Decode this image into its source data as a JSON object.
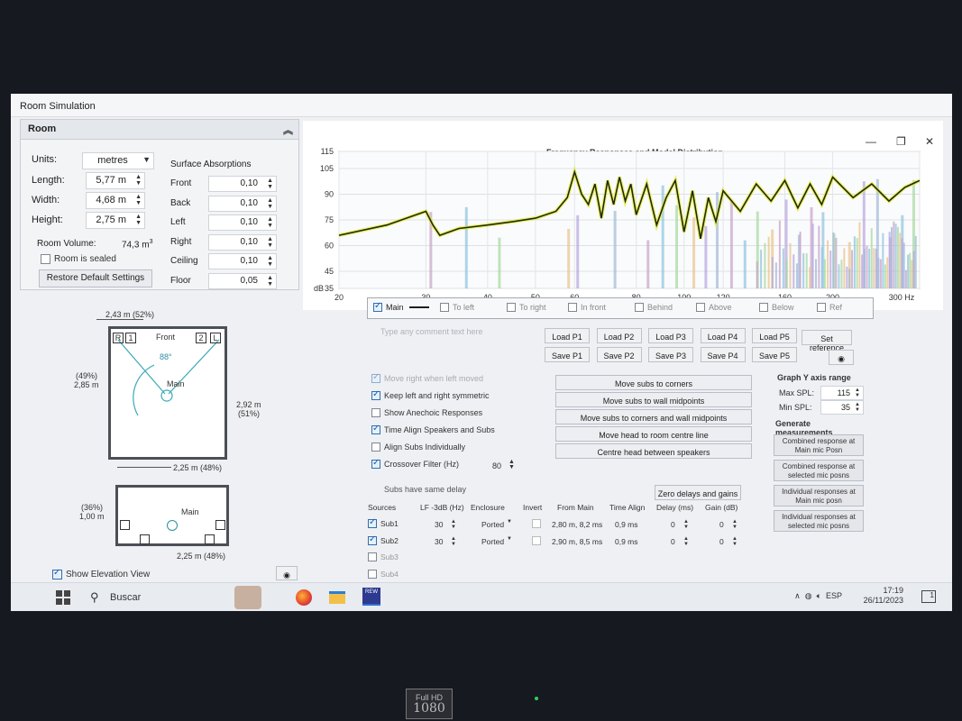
{
  "window_title": "Room Simulation",
  "room_panel": {
    "title": "Room",
    "units_label": "Units:",
    "units_value": "metres",
    "length_label": "Length:",
    "length_value": "5,77 m",
    "width_label": "Width:",
    "width_value": "4,68 m",
    "height_label": "Height:",
    "height_value": "2,75 m",
    "volume_label": "Room Volume:",
    "volume_value": "74,3 m",
    "volume_exp": "3",
    "sealed_label": "Room is sealed",
    "restore_label": "Restore Default Settings",
    "surface_title": "Surface Absorptions",
    "surfaces": [
      {
        "label": "Front",
        "value": "0,10"
      },
      {
        "label": "Back",
        "value": "0,10"
      },
      {
        "label": "Left",
        "value": "0,10"
      },
      {
        "label": "Right",
        "value": "0,10"
      },
      {
        "label": "Ceiling",
        "value": "0,10"
      },
      {
        "label": "Floor",
        "value": "0,05"
      }
    ]
  },
  "plan_view": {
    "top_dim": "2,43 m (52%)",
    "front_label": "Front",
    "angle": "88°",
    "main_label": "Main",
    "left_dim_pct": "(49%)",
    "left_dim": "2,85 m",
    "right_dim": "2,92 m",
    "right_dim_pct": "(51%)",
    "bottom_dim": "2,25 m (48%)",
    "speaker_r": "R",
    "speaker_1": "1",
    "speaker_2": "2",
    "speaker_l": "L"
  },
  "elevation_view": {
    "left_dim_pct": "(36%)",
    "left_dim": "1,00 m",
    "main_label": "Main",
    "bottom_dim": "2,25 m (48%)",
    "show_label": "Show Elevation View"
  },
  "graph": {
    "title": "Frequency Responses and Modal Distribution",
    "y_unit": "dB",
    "y_ticks": [
      "115",
      "105",
      "90",
      "75",
      "60",
      "45",
      "35"
    ],
    "x_ticks": [
      "20",
      "30",
      "40",
      "50",
      "60",
      "80",
      "100",
      "120",
      "160",
      "200",
      "300 Hz"
    ]
  },
  "chart_data": {
    "type": "line",
    "title": "Frequency Responses and Modal Distribution",
    "xlabel": "Hz",
    "ylabel": "dB",
    "ylim": [
      35,
      115
    ],
    "xlim": [
      20,
      300
    ],
    "series": [
      {
        "name": "Main",
        "x": [
          20,
          25,
          28,
          30,
          31,
          32,
          35,
          40,
          45,
          50,
          55,
          58,
          60,
          62,
          64,
          66,
          68,
          70,
          72,
          74,
          76,
          78,
          80,
          84,
          88,
          92,
          96,
          100,
          104,
          108,
          112,
          116,
          120,
          130,
          140,
          150,
          160,
          170,
          180,
          190,
          200,
          220,
          240,
          260,
          280,
          300
        ],
        "y": [
          66,
          72,
          77,
          80,
          72,
          66,
          70,
          72,
          74,
          76,
          80,
          88,
          103,
          90,
          84,
          96,
          76,
          98,
          84,
          100,
          86,
          96,
          78,
          96,
          72,
          88,
          98,
          68,
          92,
          64,
          88,
          74,
          92,
          80,
          96,
          86,
          98,
          82,
          96,
          84,
          100,
          88,
          96,
          86,
          94,
          98
        ]
      }
    ]
  },
  "legend": {
    "items": [
      {
        "label": "Main",
        "checked": true
      },
      {
        "label": "To left",
        "checked": false
      },
      {
        "label": "To right",
        "checked": false
      },
      {
        "label": "In front",
        "checked": false
      },
      {
        "label": "Behind",
        "checked": false
      },
      {
        "label": "Above",
        "checked": false
      },
      {
        "label": "Below",
        "checked": false
      },
      {
        "label": "Ref",
        "checked": false
      }
    ]
  },
  "controls": {
    "comment_placeholder": "Type any comment text here",
    "load_buttons": [
      "Load P1",
      "Load P2",
      "Load P3",
      "Load P4",
      "Load P5"
    ],
    "save_buttons": [
      "Save P1",
      "Save P2",
      "Save P3",
      "Save P4",
      "Save P5"
    ],
    "set_reference": "Set reference",
    "options": [
      {
        "label": "Move right when left moved",
        "checked": true,
        "disabled": true
      },
      {
        "label": "Keep left and right symmetric",
        "checked": true
      },
      {
        "label": "Show Anechoic Responses",
        "checked": false
      },
      {
        "label": "Time Align Speakers and Subs",
        "checked": true
      },
      {
        "label": "Align Subs Individually",
        "checked": false
      },
      {
        "label": "Crossover Filter (Hz)",
        "checked": true
      }
    ],
    "crossover_value": "80",
    "subs_same_delay": "Subs have same delay",
    "action_buttons": [
      "Move subs to corners",
      "Move subs to wall midpoints",
      "Move subs to corners and wall midpoints",
      "Move head to room centre line",
      "Centre head between speakers"
    ],
    "zero_delays": "Zero delays and gains"
  },
  "sources_table": {
    "headers": [
      "Sources",
      "LF -3dB (Hz)",
      "Enclosure",
      "Invert",
      "From Main",
      "Time Align",
      "Delay (ms)",
      "Gain (dB)"
    ],
    "rows": [
      {
        "name": "Sub1",
        "checked": true,
        "lf": "30",
        "enclosure": "Ported",
        "from_main": "2,80 m, 8,2 ms",
        "time_align": "0,9 ms",
        "delay": "0",
        "gain": "0"
      },
      {
        "name": "Sub2",
        "checked": true,
        "lf": "30",
        "enclosure": "Ported",
        "from_main": "2,90 m, 8,5 ms",
        "time_align": "0,9 ms",
        "delay": "0",
        "gain": "0"
      },
      {
        "name": "Sub3",
        "checked": false
      },
      {
        "name": "Sub4",
        "checked": false
      }
    ]
  },
  "right_panel": {
    "y_axis_title": "Graph Y axis range",
    "max_label": "Max SPL:",
    "max_value": "115",
    "min_label": "Min SPL:",
    "min_value": "35",
    "generate_title": "Generate measurements",
    "buttons": [
      "Combined response at Main mic Posn",
      "Combined response at selected mic posns",
      "Individual responses at Main mic posn",
      "Individual responses at selected mic posns"
    ]
  },
  "taskbar": {
    "search_label": "Buscar",
    "language": "ESP",
    "time": "17:19",
    "date": "26/11/2023",
    "notification_count": "1",
    "rew_label": "REW"
  },
  "monitor": {
    "badge_top": "Full HD",
    "badge_bottom": "1080"
  }
}
